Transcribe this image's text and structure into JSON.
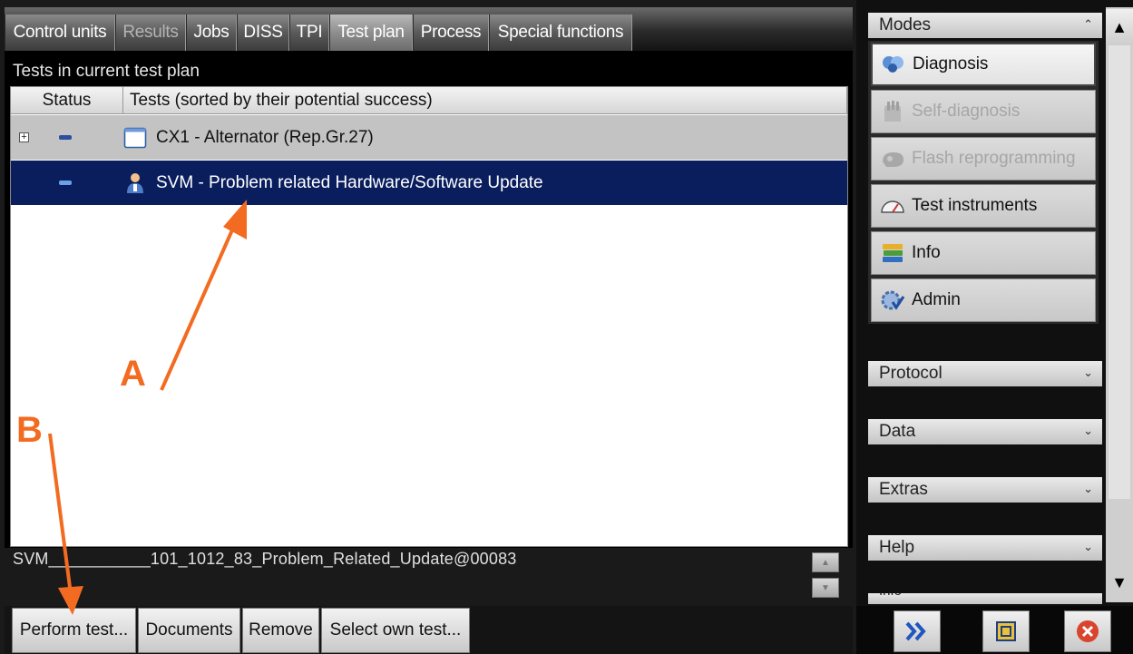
{
  "tabs": [
    {
      "label": "Control units",
      "state": "normal"
    },
    {
      "label": "Results",
      "state": "disabled"
    },
    {
      "label": "Jobs",
      "state": "normal"
    },
    {
      "label": "DISS",
      "state": "normal"
    },
    {
      "label": "TPI",
      "state": "normal"
    },
    {
      "label": "Test plan",
      "state": "active"
    },
    {
      "label": "Process",
      "state": "normal"
    },
    {
      "label": "Special functions",
      "state": "normal"
    }
  ],
  "test_plan": {
    "section_title": "Tests in current test plan",
    "columns": [
      "Status",
      "Tests (sorted by their potential success)"
    ],
    "rows": [
      {
        "icon": "window-icon",
        "label": "CX1 - Alternator (Rep.Gr.27)",
        "expandable": true,
        "selected": false
      },
      {
        "icon": "person-icon",
        "label": "SVM - Problem related Hardware/Software Update",
        "expandable": false,
        "selected": true
      }
    ],
    "selected_path": "SVM___________101_1012_83_Problem_Related_Update@00083"
  },
  "buttons": {
    "perform": "Perform test...",
    "documents": "Documents",
    "remove": "Remove",
    "select_own": "Select own test..."
  },
  "modes": {
    "header": "Modes",
    "items": [
      {
        "label": "Diagnosis",
        "icon": "stethoscope-icon",
        "state": "selected"
      },
      {
        "label": "Self-diagnosis",
        "icon": "hand-icon",
        "state": "disabled"
      },
      {
        "label": "Flash reprogramming",
        "icon": "chip-icon",
        "state": "disabled"
      },
      {
        "label": "Test instruments",
        "icon": "gauge-icon",
        "state": "normal"
      },
      {
        "label": "Info",
        "icon": "books-icon",
        "state": "normal"
      },
      {
        "label": "Admin",
        "icon": "gear-check-icon",
        "state": "normal"
      }
    ]
  },
  "side_sections": [
    "Protocol",
    "Data",
    "Extras",
    "Help",
    "Info"
  ],
  "annotations": {
    "a": "A",
    "b": "B"
  },
  "colors": {
    "accent_selected": "#0a1e5e",
    "annotation": "#f36b21"
  }
}
